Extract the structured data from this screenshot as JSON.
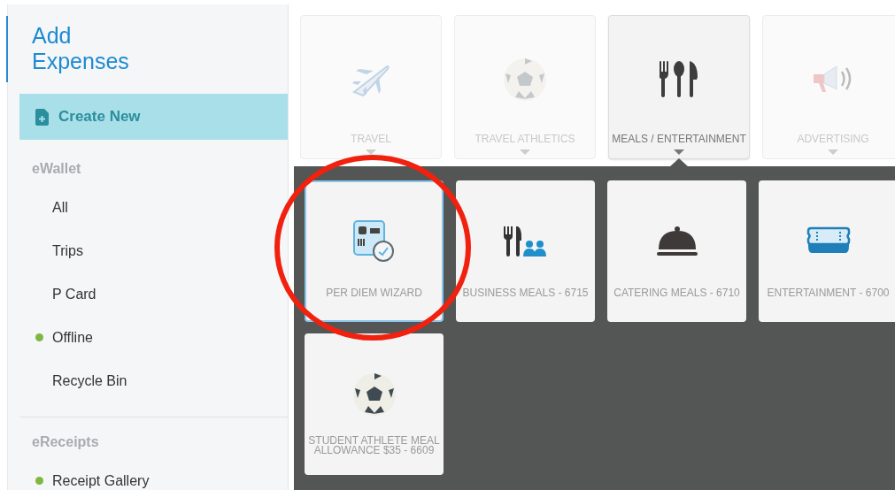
{
  "sidebar": {
    "title": "Add Expenses",
    "create_button": "Create New",
    "sections": [
      {
        "heading": "eWallet",
        "items": [
          {
            "label": "All",
            "dot": false
          },
          {
            "label": "Trips",
            "dot": false
          },
          {
            "label": "P Card",
            "dot": false
          },
          {
            "label": "Offline",
            "dot": true
          },
          {
            "label": "Recycle Bin",
            "dot": false
          }
        ]
      },
      {
        "heading": "eReceipts",
        "items": [
          {
            "label": "Receipt Gallery",
            "dot": true
          }
        ]
      }
    ]
  },
  "categories": [
    {
      "label": "TRAVEL",
      "kind": "plane",
      "selected": false
    },
    {
      "label": "TRAVEL ATHLETICS",
      "kind": "ball",
      "selected": false
    },
    {
      "label": "MEALS / ENTERTAINMENT",
      "kind": "cutlery",
      "selected": true
    },
    {
      "label": "ADVERTISING",
      "kind": "megaphone",
      "selected": false
    }
  ],
  "expense_types": [
    {
      "label": "PER DIEM WIZARD",
      "kind": "perdiem",
      "selected": true
    },
    {
      "label": "BUSINESS MEALS - 6715",
      "kind": "meals",
      "selected": false
    },
    {
      "label": "CATERING MEALS - 6710",
      "kind": "cloche",
      "selected": false
    },
    {
      "label": "ENTERTAINMENT - 6700",
      "kind": "ticket",
      "selected": false
    },
    {
      "label": "STUDENT ATHLETE MEAL ALLOWANCE $35 - 6609",
      "kind": "ball",
      "selected": false
    }
  ],
  "annotation": {
    "kind": "circle"
  }
}
